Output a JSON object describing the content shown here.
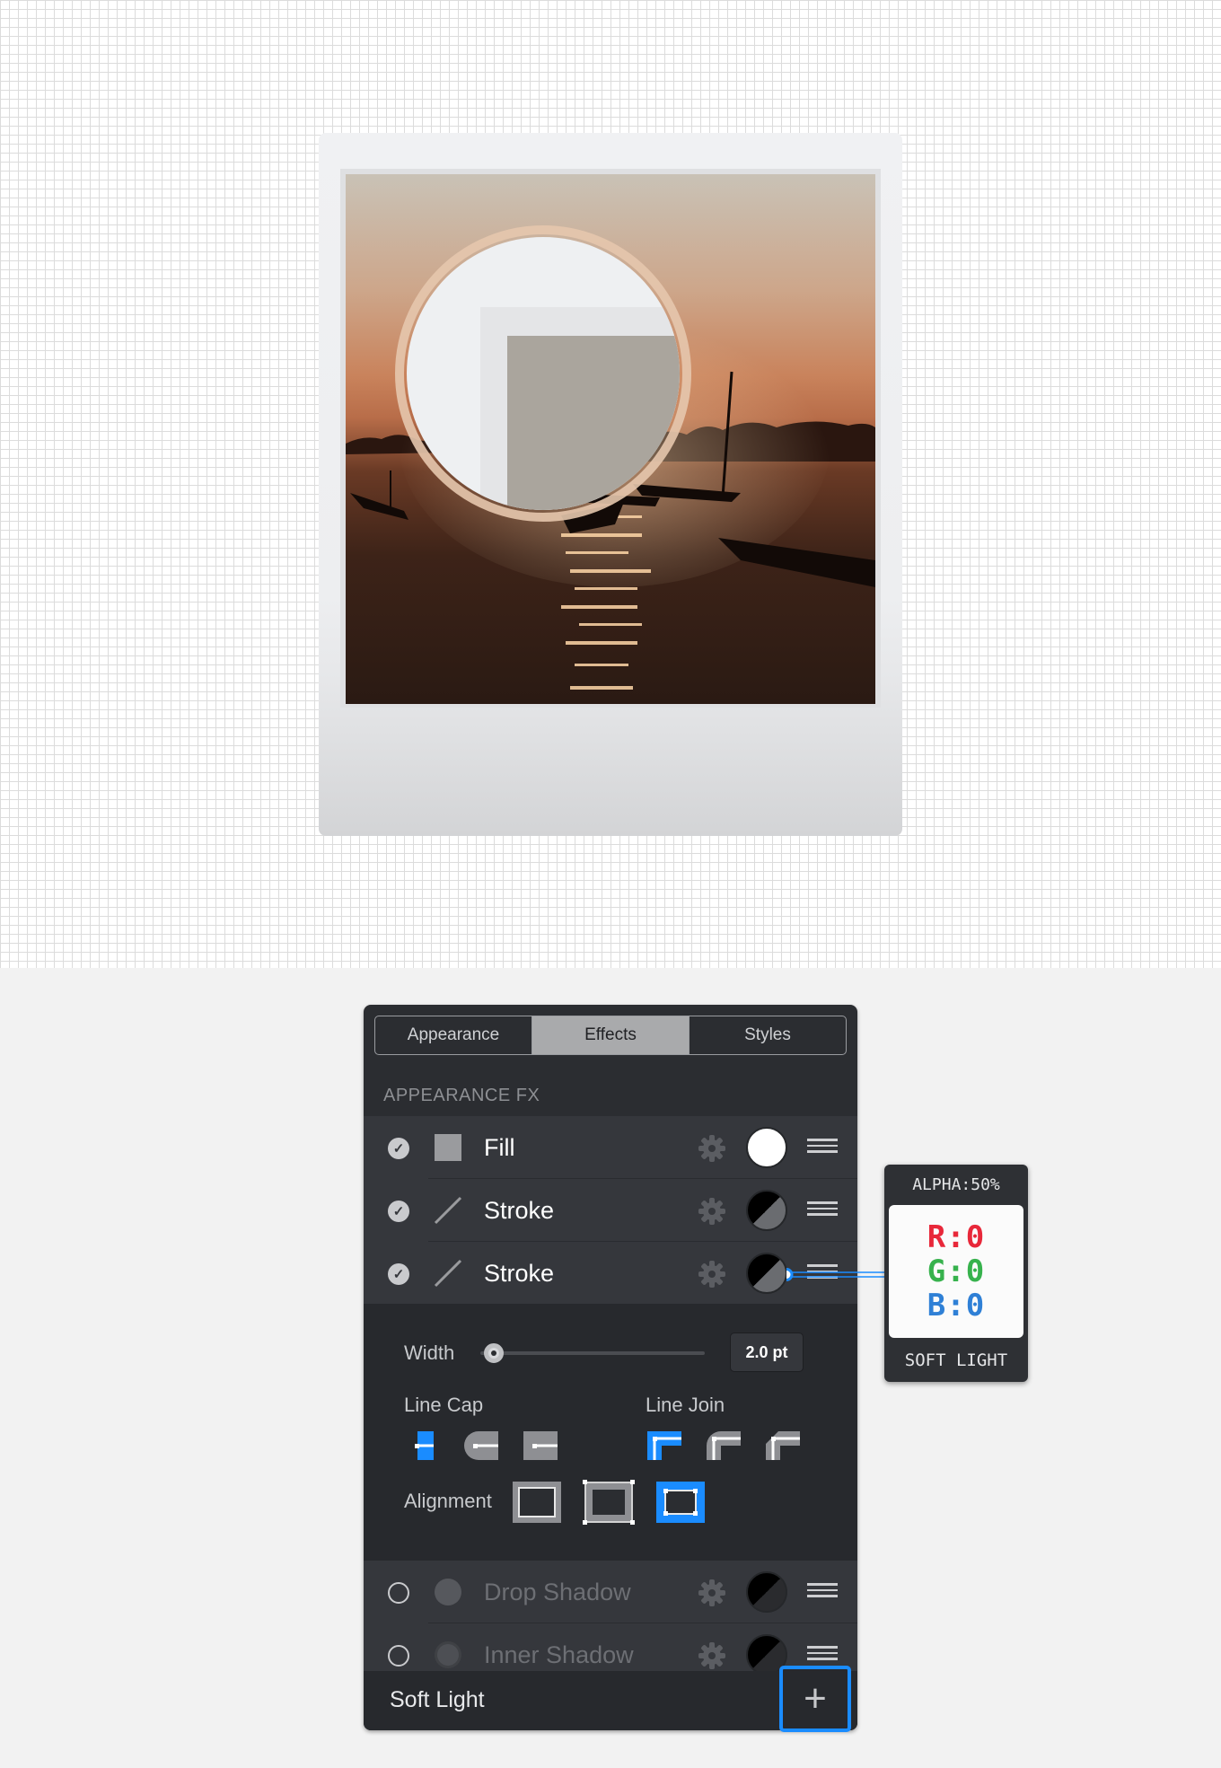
{
  "tabs": [
    {
      "label": "Appearance",
      "active": false
    },
    {
      "label": "Effects",
      "active": true
    },
    {
      "label": "Styles",
      "active": false
    }
  ],
  "section_header": "APPEARANCE FX",
  "fx_rows": [
    {
      "label": "Fill",
      "enabled": true,
      "icon": "square-fill-icon",
      "swatch": "white"
    },
    {
      "label": "Stroke",
      "enabled": true,
      "icon": "stroke-line-icon",
      "swatch": "half-black-gray"
    },
    {
      "label": "Stroke",
      "enabled": true,
      "icon": "stroke-line-icon",
      "swatch": "half-black-gray"
    },
    {
      "label": "Drop Shadow",
      "enabled": false,
      "icon": "circle-shadow-icon",
      "swatch": "half-black-gray"
    },
    {
      "label": "Inner Shadow",
      "enabled": false,
      "icon": "circle-shadow-icon",
      "swatch": "half-black-gray"
    }
  ],
  "stroke_settings": {
    "width_label": "Width",
    "width_value": "2.0 pt",
    "line_cap_label": "Line Cap",
    "line_join_label": "Line Join",
    "alignment_label": "Alignment",
    "selected_cap": "butt",
    "selected_join": "miter",
    "selected_alignment": "outside"
  },
  "footer": {
    "blend_mode": "Soft Light",
    "add_symbol": "+"
  },
  "popover": {
    "alpha": "ALPHA:50%",
    "r": "R:0",
    "g": "G:0",
    "b": "B:0",
    "blend": "SOFT LIGHT"
  },
  "colors": {
    "accent": "#1a8cff",
    "panel_bg": "#2b2d31",
    "row_bg": "#35373c",
    "r_color": "#e8283a",
    "g_color": "#37b24d",
    "b_color": "#2f80d6"
  }
}
